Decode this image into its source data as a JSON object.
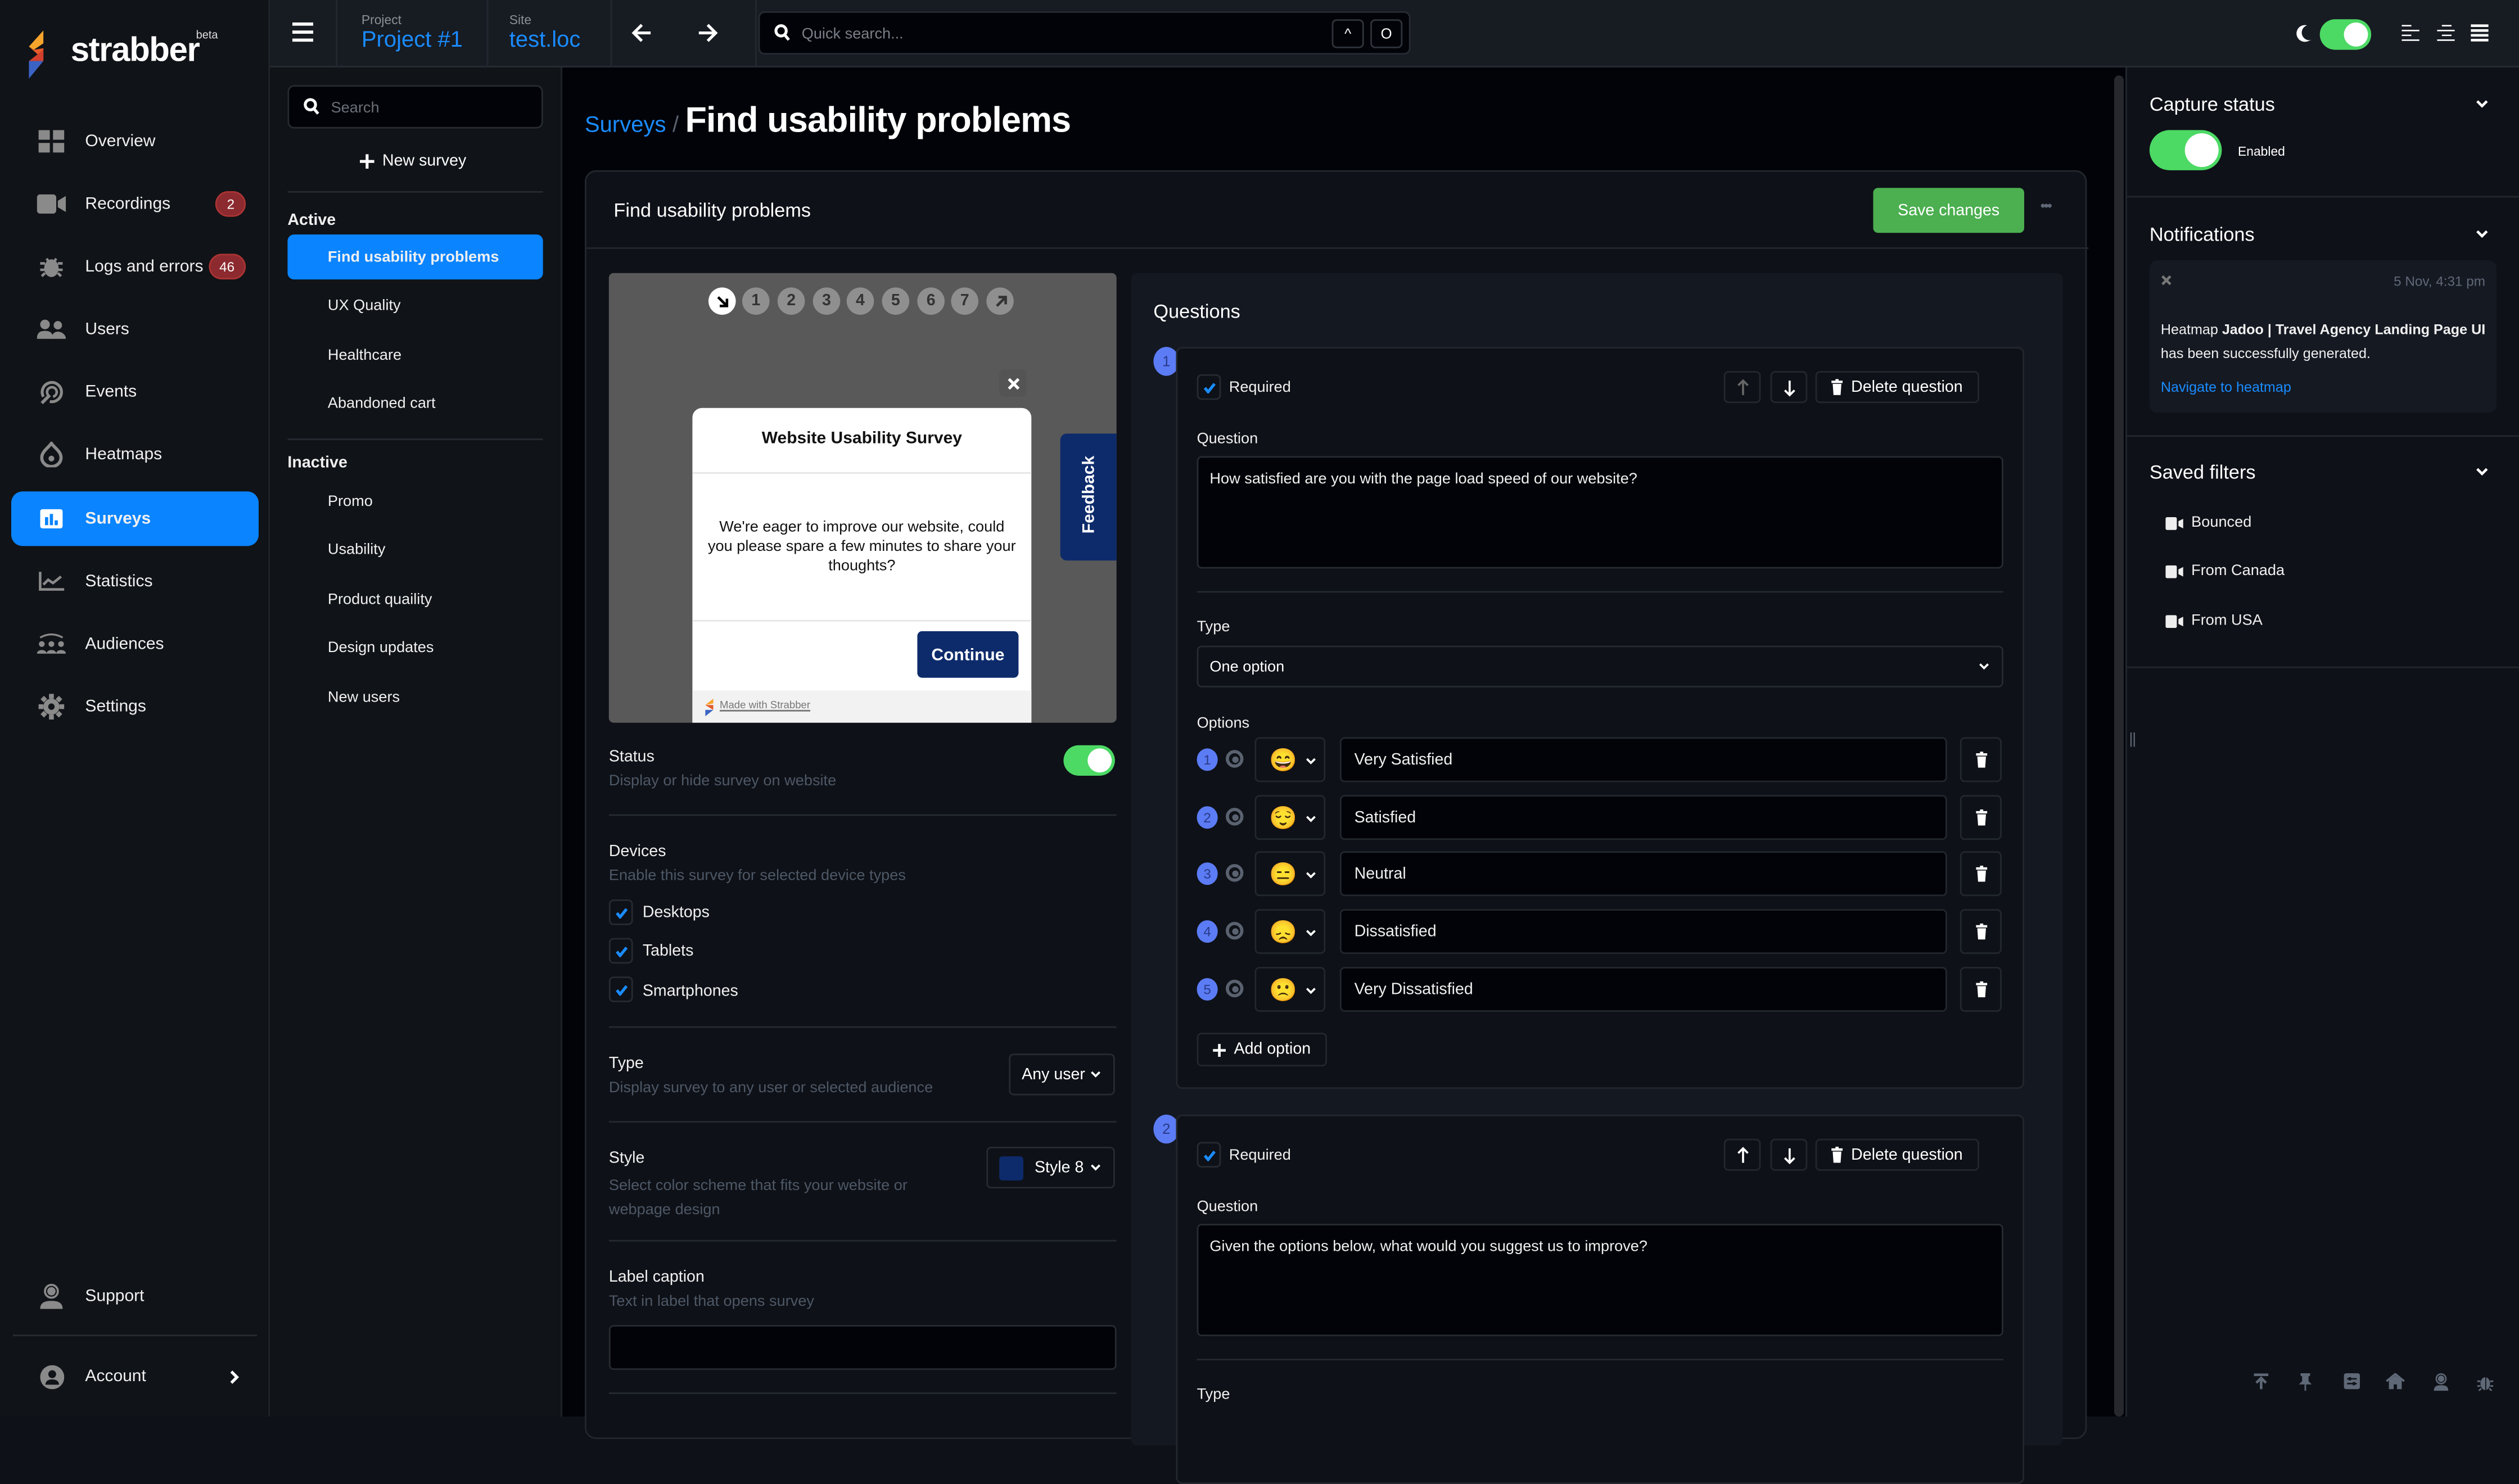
{
  "app": {
    "name": "strabber",
    "badge": "beta"
  },
  "colors": {
    "accent": "#0a84ff",
    "success": "#4caf50",
    "toggle_on": "#4cd964",
    "badge": "#8c2a2f",
    "survey_style": "#0d2b6b",
    "question_number": "#5b7cf5"
  },
  "topbar": {
    "project_label": "Project",
    "project_value": "Project #1",
    "site_label": "Site",
    "site_value": "test.loc",
    "search_placeholder": "Quick search...",
    "shortcut_keys": [
      "^",
      "O"
    ],
    "dark_mode": true
  },
  "nav": {
    "items": [
      {
        "label": "Overview",
        "icon": "grid-icon"
      },
      {
        "label": "Recordings",
        "icon": "video-icon",
        "badge": "2"
      },
      {
        "label": "Logs and errors",
        "icon": "bug-icon",
        "badge": "46"
      },
      {
        "label": "Users",
        "icon": "users-icon"
      },
      {
        "label": "Events",
        "icon": "events-icon"
      },
      {
        "label": "Heatmaps",
        "icon": "heatmap-icon"
      },
      {
        "label": "Surveys",
        "icon": "survey-icon",
        "active": true
      },
      {
        "label": "Statistics",
        "icon": "chart-icon"
      },
      {
        "label": "Audiences",
        "icon": "audience-icon"
      },
      {
        "label": "Settings",
        "icon": "gear-icon"
      }
    ],
    "support": "Support",
    "account": "Account"
  },
  "surveys_list": {
    "search_placeholder": "Search",
    "new_survey": "New survey",
    "active_label": "Active",
    "active": [
      "Find usability problems",
      "UX Quality",
      "Healthcare",
      "Abandoned cart"
    ],
    "inactive_label": "Inactive",
    "inactive": [
      "Promo",
      "Usability",
      "Product quaility",
      "Design updates",
      "New users"
    ]
  },
  "main": {
    "breadcrumb_parent": "Surveys",
    "breadcrumb_sep": "/",
    "page_title": "Find usability problems",
    "card_title": "Find usability problems",
    "save_label": "Save changes",
    "more_label": "•••",
    "preview": {
      "steps": [
        "1",
        "2",
        "3",
        "4",
        "5",
        "6",
        "7"
      ],
      "modal_title": "Website Usability Survey",
      "modal_body": "We're eager to improve our website, could you please spare a few minutes to share your thoughts?",
      "continue_label": "Continue",
      "made_with": "Made with Strabber",
      "feedback_tab": "Feedback"
    },
    "settings": {
      "status_title": "Status",
      "status_sub": "Display or hide survey on website",
      "status_on": true,
      "devices_title": "Devices",
      "devices_sub": "Enable this survey for selected device types",
      "devices": [
        {
          "label": "Desktops",
          "checked": true
        },
        {
          "label": "Tablets",
          "checked": true
        },
        {
          "label": "Smartphones",
          "checked": true
        }
      ],
      "type_title": "Type",
      "type_sub": "Display survey to any user or selected audience",
      "type_value": "Any user",
      "style_title": "Style",
      "style_sub": "Select color scheme that fits your website or webpage design",
      "style_value": "Style 8",
      "label_title": "Label caption",
      "label_sub": "Text in label that opens survey",
      "label_value": ""
    },
    "questions": {
      "title": "Questions",
      "items": [
        {
          "number": "1",
          "required_label": "Required",
          "required": true,
          "delete_label": "Delete question",
          "question_label": "Question",
          "question_text": "How satisfied are you with the page load speed of our website?",
          "type_label": "Type",
          "type_value": "One option",
          "options_label": "Options",
          "options": [
            {
              "n": "1",
              "emoji": "😄",
              "text": "Very Satisfied"
            },
            {
              "n": "2",
              "emoji": "😌",
              "text": "Satisfied"
            },
            {
              "n": "3",
              "emoji": "😑",
              "text": "Neutral"
            },
            {
              "n": "4",
              "emoji": "😞",
              "text": "Dissatisfied"
            },
            {
              "n": "5",
              "emoji": "🙁",
              "text": "Very Dissatisfied"
            }
          ],
          "add_option": "Add option"
        },
        {
          "number": "2",
          "required_label": "Required",
          "required": true,
          "delete_label": "Delete question",
          "question_label": "Question",
          "question_text": "Given the options below, what would you suggest us to improve?",
          "type_label": "Type"
        }
      ]
    }
  },
  "right_panel": {
    "capture_title": "Capture status",
    "capture_state": "Enabled",
    "capture_on": true,
    "notifications_title": "Notifications",
    "notification": {
      "time": "5 Nov, 4:31 pm",
      "prefix": "Heatmap ",
      "bold": "Jadoo | Travel Agency Landing Page UI",
      "suffix": " has been successfully generated.",
      "link": "Navigate to heatmap"
    },
    "saved_filters_title": "Saved filters",
    "saved_filters": [
      "Bounced",
      "From Canada",
      "From USA"
    ],
    "bottom_icons": [
      "scroll-top-icon",
      "pin-icon",
      "sliders-icon",
      "home-icon",
      "support-icon",
      "bug-icon"
    ]
  }
}
